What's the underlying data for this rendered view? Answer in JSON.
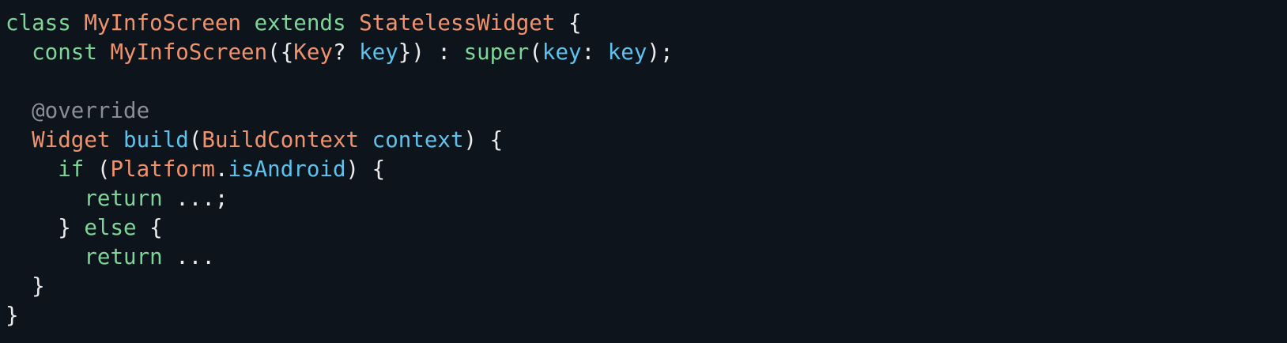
{
  "theme": {
    "background": "#0d141c",
    "keyword": "#7fd598",
    "type": "#f0936d",
    "function": "#5ec2ec",
    "annotation": "#8a8f96",
    "plain": "#ececec"
  },
  "code_lines": [
    [
      {
        "text": "class",
        "kind": "keyword"
      },
      {
        "text": " ",
        "kind": "plain"
      },
      {
        "text": "MyInfoScreen",
        "kind": "type"
      },
      {
        "text": " ",
        "kind": "plain"
      },
      {
        "text": "extends",
        "kind": "keyword"
      },
      {
        "text": " ",
        "kind": "plain"
      },
      {
        "text": "StatelessWidget",
        "kind": "type"
      },
      {
        "text": " {",
        "kind": "plain"
      }
    ],
    [
      {
        "text": "  ",
        "kind": "plain"
      },
      {
        "text": "const",
        "kind": "keyword"
      },
      {
        "text": " ",
        "kind": "plain"
      },
      {
        "text": "MyInfoScreen",
        "kind": "type"
      },
      {
        "text": "({",
        "kind": "plain"
      },
      {
        "text": "Key",
        "kind": "type"
      },
      {
        "text": "? ",
        "kind": "plain"
      },
      {
        "text": "key",
        "kind": "param"
      },
      {
        "text": "}) : ",
        "kind": "plain"
      },
      {
        "text": "super",
        "kind": "keyword"
      },
      {
        "text": "(",
        "kind": "plain"
      },
      {
        "text": "key",
        "kind": "param"
      },
      {
        "text": ": ",
        "kind": "plain"
      },
      {
        "text": "key",
        "kind": "param"
      },
      {
        "text": ");",
        "kind": "plain"
      }
    ],
    [],
    [
      {
        "text": "  ",
        "kind": "plain"
      },
      {
        "text": "@override",
        "kind": "annotation"
      }
    ],
    [
      {
        "text": "  ",
        "kind": "plain"
      },
      {
        "text": "Widget",
        "kind": "type"
      },
      {
        "text": " ",
        "kind": "plain"
      },
      {
        "text": "build",
        "kind": "function"
      },
      {
        "text": "(",
        "kind": "plain"
      },
      {
        "text": "BuildContext",
        "kind": "type"
      },
      {
        "text": " ",
        "kind": "plain"
      },
      {
        "text": "context",
        "kind": "param"
      },
      {
        "text": ") {",
        "kind": "plain"
      }
    ],
    [
      {
        "text": "    ",
        "kind": "plain"
      },
      {
        "text": "if",
        "kind": "keyword"
      },
      {
        "text": " (",
        "kind": "plain"
      },
      {
        "text": "Platform",
        "kind": "type"
      },
      {
        "text": ".",
        "kind": "plain"
      },
      {
        "text": "isAndroid",
        "kind": "function"
      },
      {
        "text": ") {",
        "kind": "plain"
      }
    ],
    [
      {
        "text": "      ",
        "kind": "plain"
      },
      {
        "text": "return",
        "kind": "keyword"
      },
      {
        "text": " ...;",
        "kind": "plain"
      }
    ],
    [
      {
        "text": "    } ",
        "kind": "plain"
      },
      {
        "text": "else",
        "kind": "keyword"
      },
      {
        "text": " {",
        "kind": "plain"
      }
    ],
    [
      {
        "text": "      ",
        "kind": "plain"
      },
      {
        "text": "return",
        "kind": "keyword"
      },
      {
        "text": " ...",
        "kind": "plain"
      }
    ],
    [
      {
        "text": "  }",
        "kind": "plain"
      }
    ],
    [
      {
        "text": "}",
        "kind": "plain"
      }
    ]
  ]
}
